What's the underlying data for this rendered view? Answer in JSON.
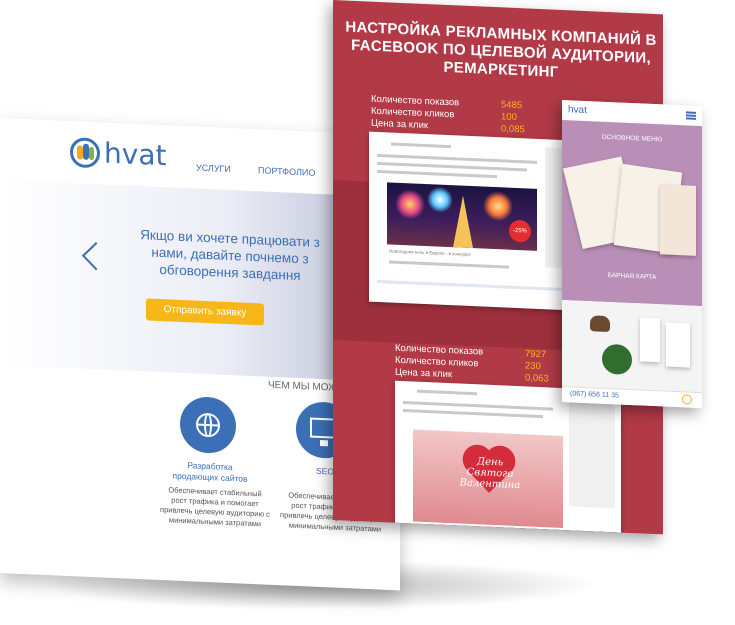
{
  "site": {
    "logo_text": "hvat",
    "nav": [
      "услуги",
      "портфолио"
    ],
    "hero_text": "Якщо ви хочете працювати з нами, давайте почнемо з обговорення завдання",
    "cta_label": "Отправить заявку",
    "section_title": "ЧЕМ МЫ МОЖЕМ",
    "services": [
      {
        "label": "Разработка продающих сайтов",
        "icon": "globe-icon",
        "desc": "Обеспечивает стабильный рост трафика и помогает привлечь целевую аудиторию с минимальными затратами"
      },
      {
        "label": "SEO",
        "icon": "monitor-chart-icon",
        "desc": "Обеспечивает стабильный рост трафика и помогает привлечь целевую аудиторию с минимальными затратами"
      }
    ]
  },
  "ad_panel": {
    "title": "НАСТРОЙКА РЕКЛАМНЫХ КОМПАНИЙ В FACEBOOK ПО ЦЕЛЕВОЙ АУДИТОРИИ, РЕМАРКЕТИНГ",
    "stats_1": {
      "labels": [
        "Количество показов",
        "Количество кликов",
        "Цена за клик"
      ],
      "values": [
        "5485",
        "100",
        "0,085"
      ]
    },
    "stats_2": {
      "labels": [
        "Количество показов",
        "Количество кликов",
        "Цена за клик"
      ],
      "values": [
        "7927",
        "230",
        "0,063"
      ]
    },
    "card1_caption": "Новогодняя ночь в Европе - в конкурсе",
    "card1_badge": "-25%",
    "card2_heart_text": "День Святого Валентина"
  },
  "phone": {
    "logo_text": "hvat",
    "sec1_label": "основное меню",
    "sec1_label2": "барная карта",
    "phone_number": "(067) 656 11 35"
  },
  "colors": {
    "brand_blue": "#3b6fb6",
    "accent_yellow": "#f7b718",
    "ad_red": "#b23a47",
    "phone_purple": "#b98fb8"
  }
}
